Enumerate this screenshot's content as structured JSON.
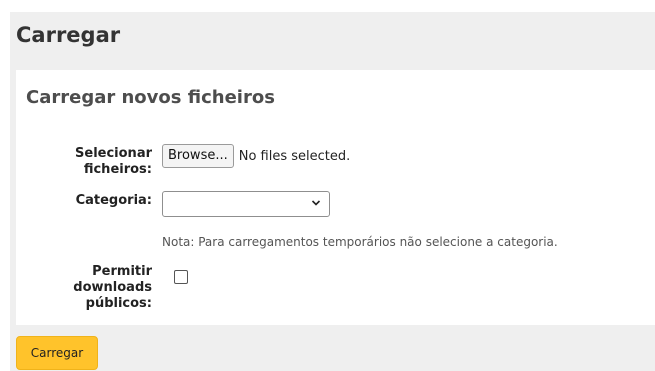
{
  "header": {
    "title": "Carregar"
  },
  "form": {
    "section_title": "Carregar novos ficheiros",
    "files_label_line1": "Selecionar",
    "files_label_line2": "ficheiros:",
    "browse_label": "Browse...",
    "file_status": "No files selected.",
    "category_label": "Categoria:",
    "category_selected": "",
    "category_note": "Nota: Para carregamentos temporários não selecione a categoria.",
    "public_label_line1": "Permitir",
    "public_label_line2": "downloads",
    "public_label_line3": "públicos:",
    "public_checked": false
  },
  "actions": {
    "submit_label": "Carregar"
  },
  "colors": {
    "page_bg": "#efefef",
    "panel_bg": "#ffffff",
    "primary_button": "#ffc32b"
  },
  "icons": {
    "select_arrow": "chevron-down-icon"
  }
}
